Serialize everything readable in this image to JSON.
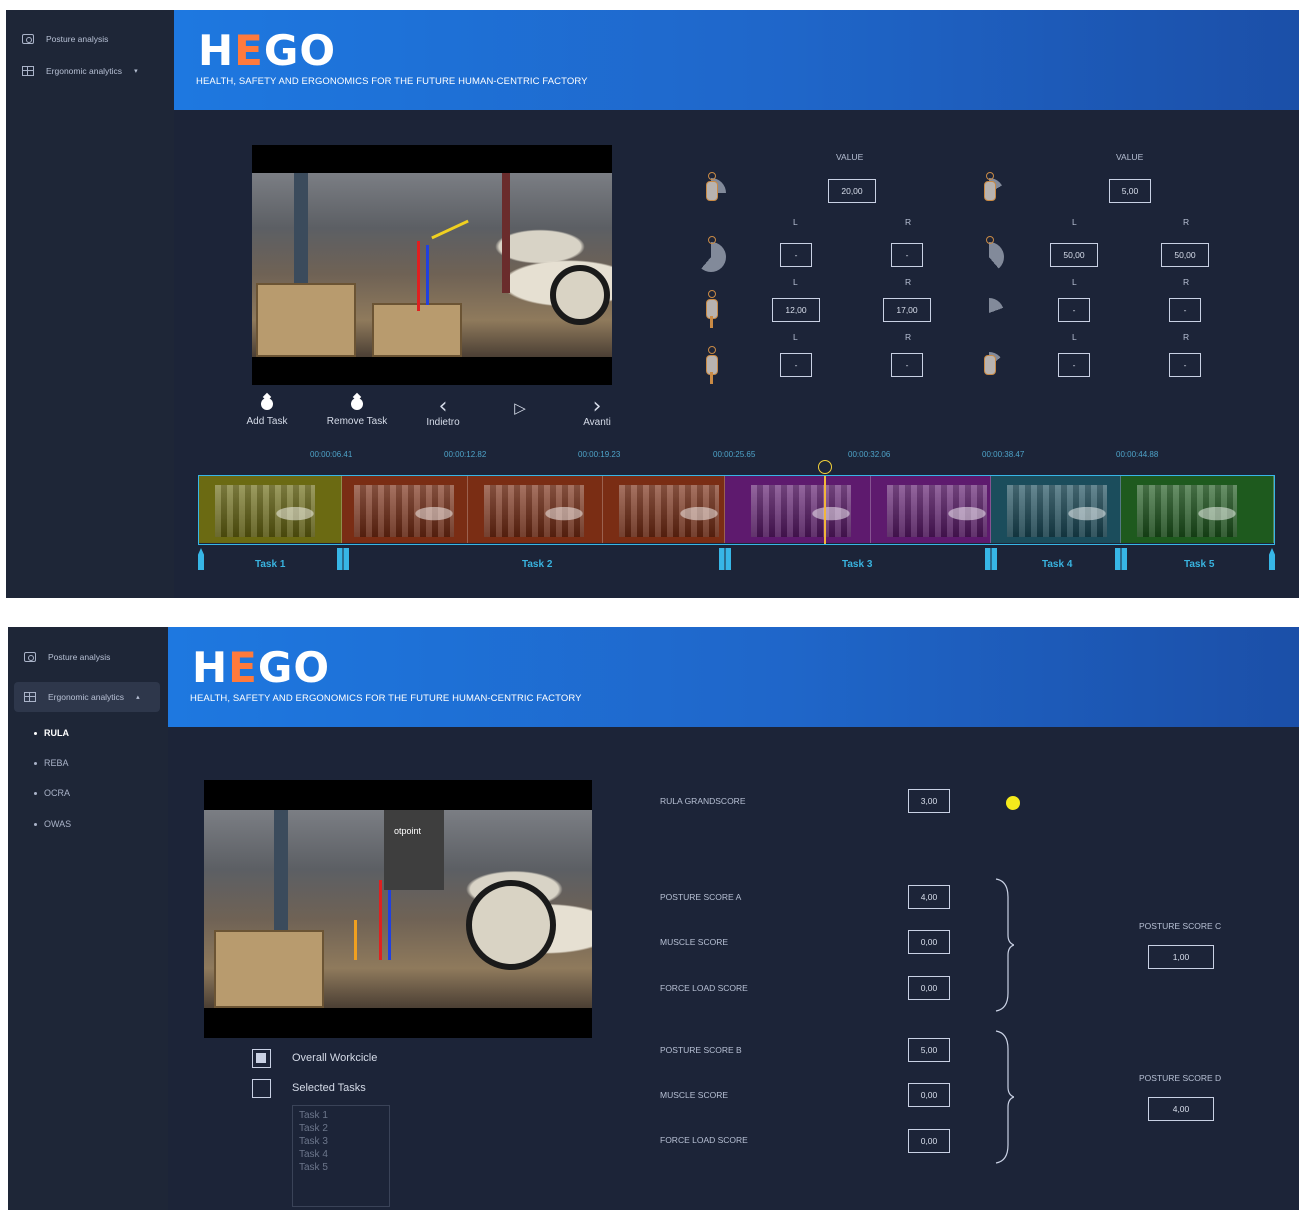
{
  "panel1": {
    "sidebar": {
      "items": [
        {
          "label": "Posture analysis",
          "icon": "camera-icon"
        },
        {
          "label": "Ergonomic analytics",
          "icon": "grid-icon",
          "caret": "▾"
        }
      ]
    },
    "header": {
      "logo": "HEGO",
      "tagline": "HEALTH, SAFETY AND ERGONOMICS FOR THE FUTURE HUMAN-CENTRIC FACTORY"
    },
    "controls": {
      "add_task": "Add Task",
      "remove_task": "Remove Task",
      "indietro": "Indietro",
      "avanti": "Avanti"
    },
    "angles": {
      "value_label": "VALUE",
      "left_label": "L",
      "right_label": "R",
      "left_col": {
        "value": "20,00",
        "rows": [
          {
            "l": "-",
            "r": "-"
          },
          {
            "l": "12,00",
            "r": "17,00"
          },
          {
            "l": "-",
            "r": "-"
          }
        ]
      },
      "right_col": {
        "value": "5,00",
        "rows": [
          {
            "l": "50,00",
            "r": "50,00"
          },
          {
            "l": "-",
            "r": "-"
          },
          {
            "l": "-",
            "r": "-"
          }
        ]
      }
    },
    "timeline": {
      "times": [
        "00:00:06.41",
        "00:00:12.82",
        "00:00:19.23",
        "00:00:25.65",
        "00:00:32.06",
        "00:00:38.47",
        "00:00:44.88"
      ],
      "tasks": [
        "Task 1",
        "Task 2",
        "Task 3",
        "Task 4",
        "Task 5"
      ],
      "colors": {
        "task1": "#6b6a12",
        "task2": "#7a2d14",
        "task3": "#5e1a6e",
        "task4": "#1b4d5c",
        "task5": "#1e5a1e",
        "playhead": "#f2b63a"
      }
    }
  },
  "panel2": {
    "sidebar": {
      "items": [
        {
          "label": "Posture analysis",
          "icon": "camera-icon"
        },
        {
          "label": "Ergonomic analytics",
          "icon": "grid-icon",
          "caret": "▴"
        }
      ],
      "sub_items": [
        "RULA",
        "REBA",
        "OCRA",
        "OWAS"
      ],
      "selected": "RULA"
    },
    "header": {
      "logo": "HEGO",
      "tagline": "HEALTH, SAFETY AND ERGONOMICS FOR THE FUTURE HUMAN-CENTRIC FACTORY"
    },
    "video_sign": "otpoint",
    "options": {
      "overall": "Overall Workcicle",
      "selected": "Selected Tasks",
      "task_list": [
        "Task 1",
        "Task 2",
        "Task 3",
        "Task 4",
        "Task 5"
      ]
    },
    "scores": {
      "grandscore_label": "RULA GRANDSCORE",
      "grandscore_value": "3,00",
      "indicator_color": "#f5ea1c",
      "group_a": [
        {
          "label": "POSTURE SCORE A",
          "value": "4,00"
        },
        {
          "label": "MUSCLE SCORE",
          "value": "0,00"
        },
        {
          "label": "FORCE LOAD SCORE",
          "value": "0,00"
        }
      ],
      "group_b": [
        {
          "label": "POSTURE SCORE B",
          "value": "5,00"
        },
        {
          "label": "MUSCLE SCORE",
          "value": "0,00"
        },
        {
          "label": "FORCE LOAD SCORE",
          "value": "0,00"
        }
      ],
      "posture_c_label": "POSTURE SCORE C",
      "posture_c_value": "1,00",
      "posture_d_label": "POSTURE SCORE D",
      "posture_d_value": "4,00"
    }
  }
}
